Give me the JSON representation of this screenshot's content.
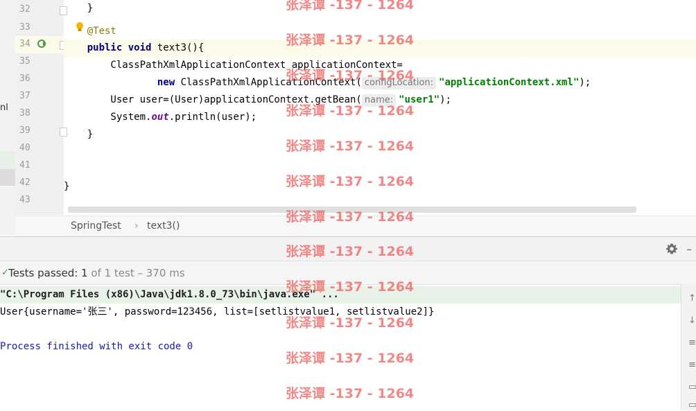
{
  "editor": {
    "lines": [
      {
        "num": "32",
        "text": "    }"
      },
      {
        "num": "33",
        "annotation": "    @Test"
      },
      {
        "num": "34",
        "kw": "    public void ",
        "text": "text3(){"
      },
      {
        "num": "35",
        "text": "        ClassPathXmlApplicationContext applicationContext="
      },
      {
        "num": "36",
        "kw": "                new ",
        "text": "ClassPathXmlApplicationContext(",
        "hint": "configLocation:",
        "str": "\"applicationContext.xml\"",
        "tail": ");"
      },
      {
        "num": "37",
        "text": "        User user=(User)applicationContext.getBean(",
        "hint": "name:",
        "str": "\"user1\"",
        "tail": ");"
      },
      {
        "num": "38",
        "text": "        System.",
        "static": "out",
        "tail": ".println(user);"
      },
      {
        "num": "39",
        "text": "    }"
      },
      {
        "num": "40",
        "text": ""
      },
      {
        "num": "41",
        "text": ""
      },
      {
        "num": "42",
        "text": "}"
      },
      {
        "num": "43",
        "text": ""
      }
    ],
    "left_fragment": "nl"
  },
  "breadcrumb": {
    "class_name": "SpringTest",
    "separator": "›",
    "method_name": "text3()"
  },
  "run_panel": {
    "status_prefix": "Tests passed: ",
    "passed_count": "1",
    "status_suffix": " of 1 test – 370 ms",
    "check_glyph": "✓",
    "console": {
      "command": "\"C:\\Program Files (x86)\\Java\\jdk1.8.0_73\\bin\\java.exe\" ...",
      "output": "User{username='张三', password=123456, list=[setlistvalue1, setlistvalue2]}",
      "process_end": "Process finished with exit code 0"
    }
  },
  "watermark": {
    "text": "张泽谭 -137 - 1264"
  },
  "icons": {
    "run": "run-test-icon",
    "bulb": "intention-bulb-icon",
    "gear": "gear-icon",
    "minimize": "minimize-icon"
  },
  "colors": {
    "keyword": "#000080",
    "annotation": "#808000",
    "string": "#008000",
    "static_field": "#660e7a",
    "current_line": "#fcfae9",
    "watermark": "#eb5a5a"
  }
}
